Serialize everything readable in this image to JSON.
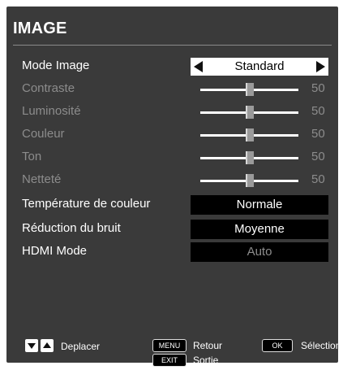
{
  "menu": {
    "title": "IMAGE"
  },
  "rows": {
    "mode_image": {
      "label": "Mode Image",
      "value": "Standard"
    },
    "contraste": {
      "label": "Contraste",
      "value": "50",
      "level": 50
    },
    "luminosite": {
      "label": "Luminosité",
      "value": "50",
      "level": 50
    },
    "couleur": {
      "label": "Couleur",
      "value": "50",
      "level": 50
    },
    "ton": {
      "label": "Ton",
      "value": "50",
      "level": 50
    },
    "nettete": {
      "label": "Netteté",
      "value": "50",
      "level": 50
    },
    "temperature": {
      "label": "Température de couleur",
      "value": "Normale"
    },
    "reduction": {
      "label": "Réduction du bruit",
      "value": "Moyenne"
    },
    "hdmi": {
      "label": "HDMI Mode",
      "value": "Auto"
    }
  },
  "footer": {
    "move_label": "Deplacer",
    "menu_key": "MENU",
    "menu_label": "Retour",
    "exit_key": "EXIT",
    "exit_label": "Sortie",
    "ok_key": "OK",
    "ok_label": "Sélection"
  },
  "colors": {
    "panel": "#3a3a3a",
    "highlight": "#ffffff",
    "disabled": "#8c8c8c"
  },
  "icons": [
    "arrow-left-icon",
    "arrow-right-icon",
    "down-arrow-icon",
    "up-arrow-icon"
  ]
}
